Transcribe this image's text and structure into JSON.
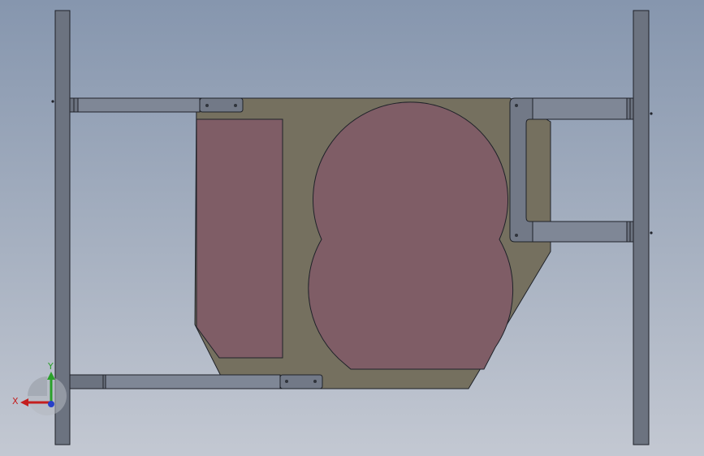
{
  "triad": {
    "x_label": "X",
    "y_label": "Y"
  },
  "colors": {
    "background_top": "#8696ae",
    "background_bottom": "#c3c8d2",
    "plate": "#75705f",
    "cutout": "#7f5d66",
    "rail": "#6c7380",
    "bar": "#7f8796",
    "bracket": "#727987",
    "outline": "#1f2229",
    "axis_x": "#c41e1e",
    "axis_y": "#2aa02a",
    "axis_z": "#2740c8"
  }
}
